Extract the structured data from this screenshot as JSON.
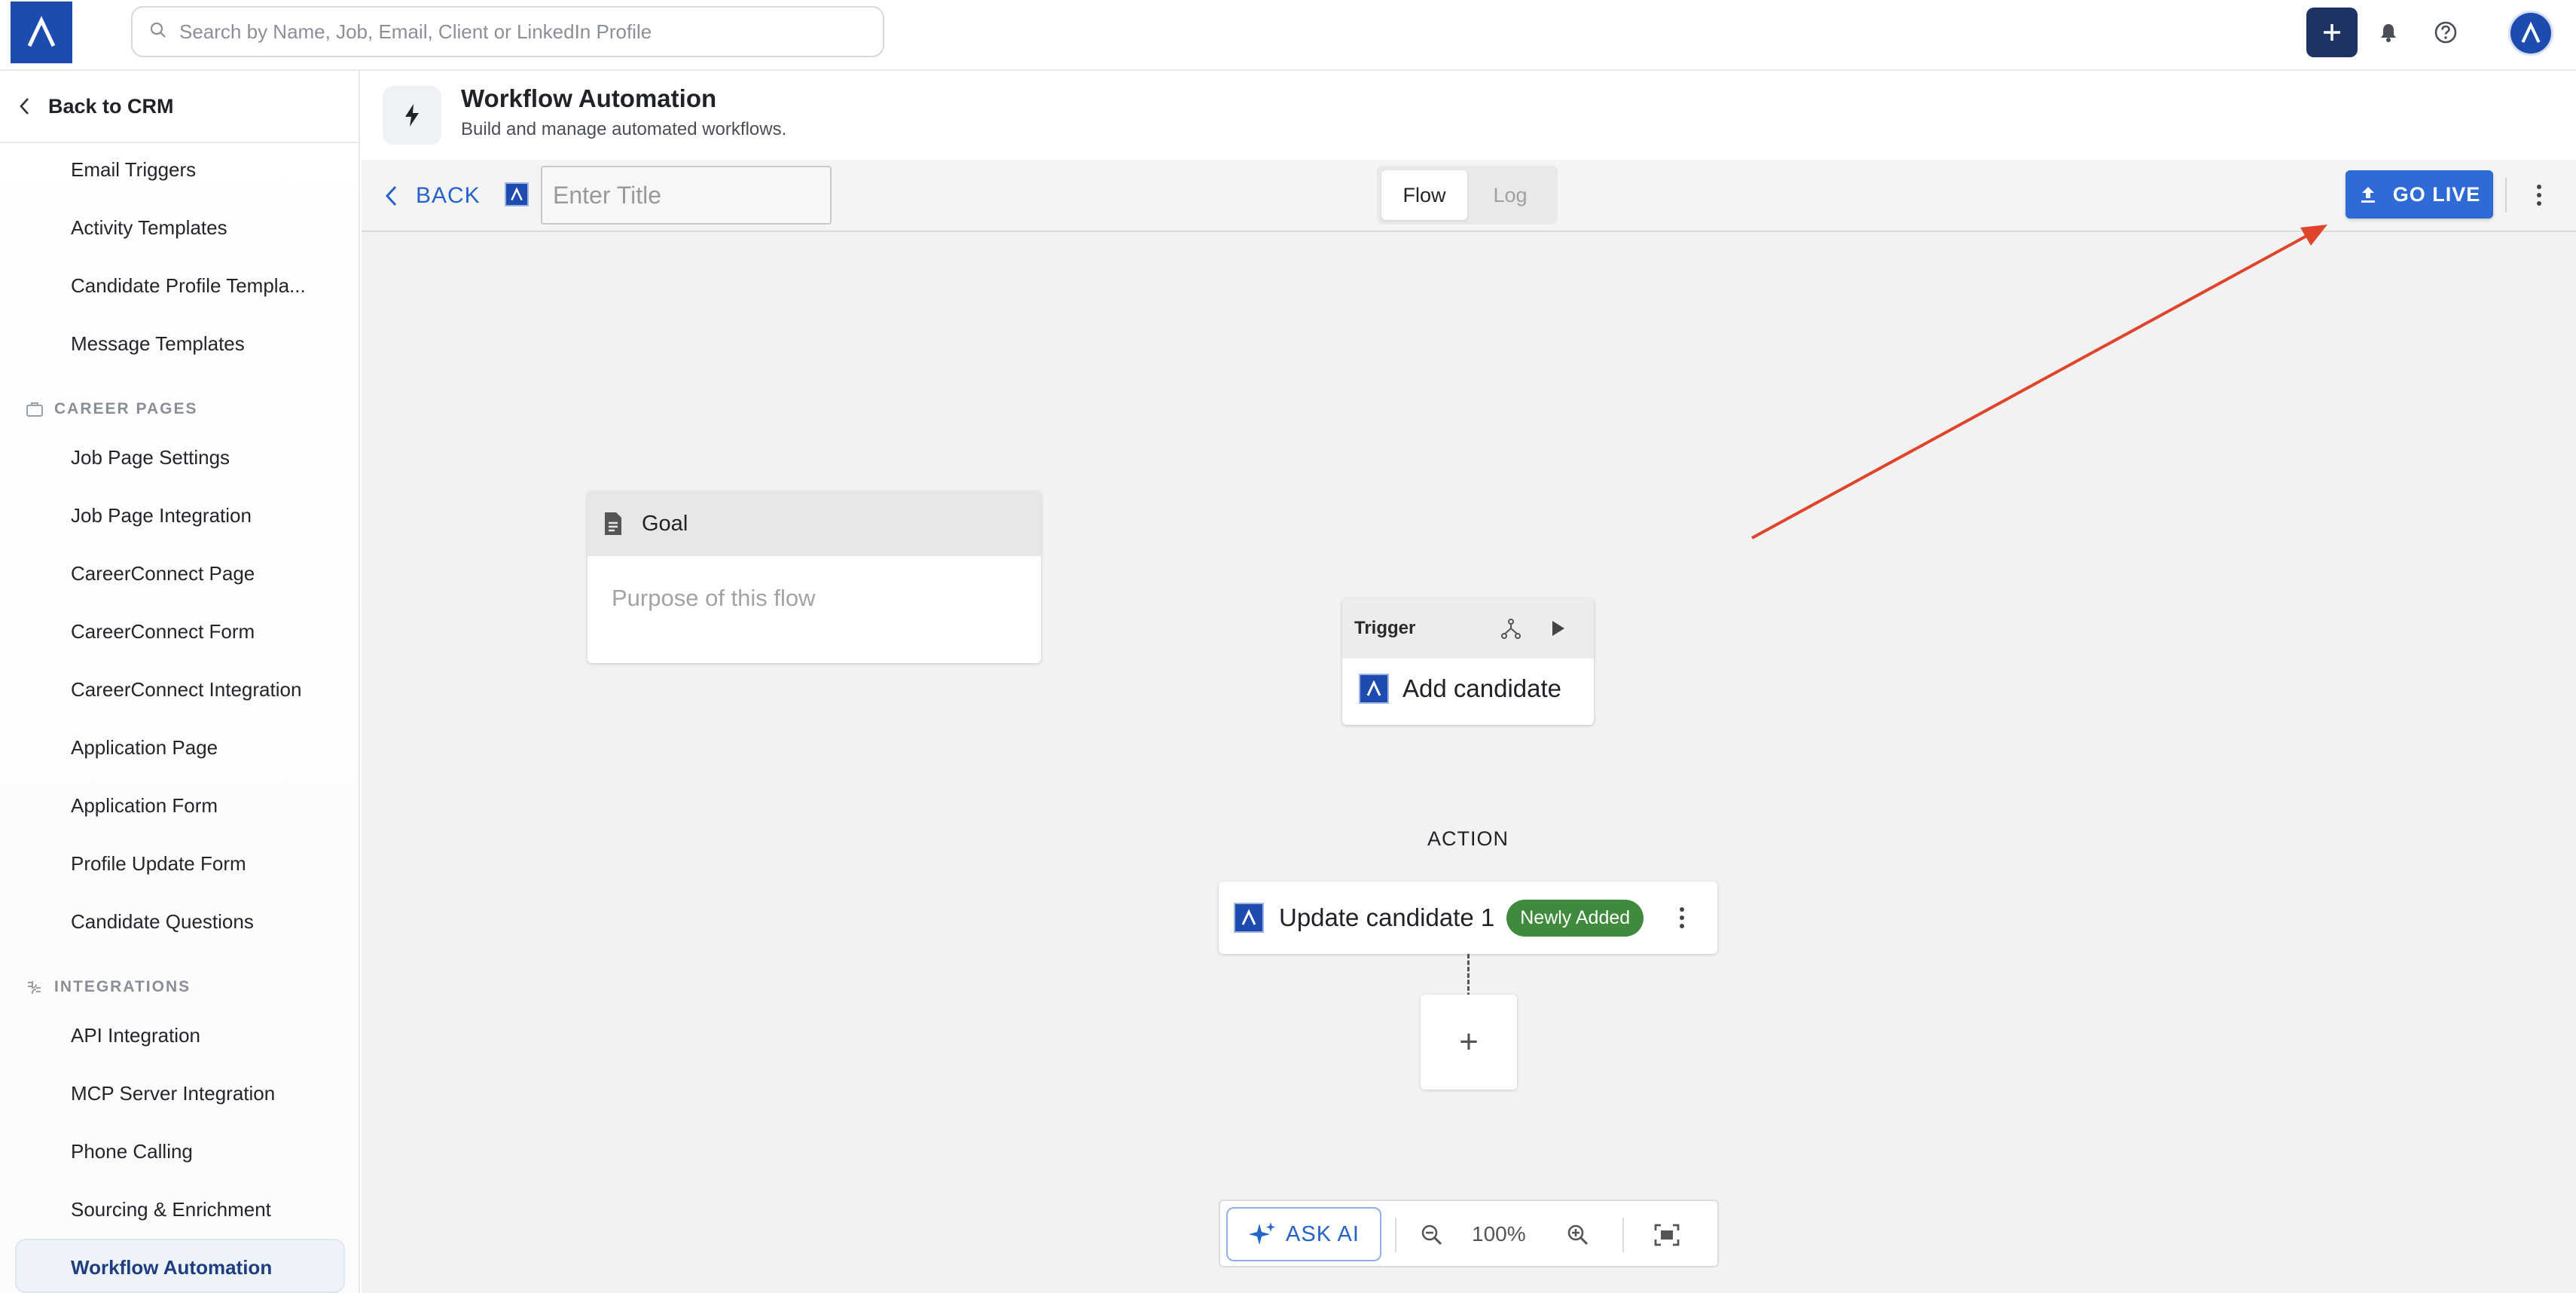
{
  "topbar": {
    "search_placeholder": "Search by Name, Job, Email, Client or LinkedIn Profile",
    "icons": [
      "logo-icon",
      "search-icon",
      "plus-icon",
      "bell-icon",
      "help-icon",
      "avatar-icon"
    ]
  },
  "sidebar": {
    "back_label": "Back to CRM",
    "items_top": [
      "Email Triggers",
      "Activity Templates",
      "Candidate Profile Templa...",
      "Message Templates"
    ],
    "career_pages_heading": "CAREER PAGES",
    "career_pages": [
      "Job Page Settings",
      "Job Page Integration",
      "CareerConnect Page",
      "CareerConnect Form",
      "CareerConnect Integration",
      "Application Page",
      "Application Form",
      "Profile Update Form",
      "Candidate Questions"
    ],
    "integrations_heading": "INTEGRATIONS",
    "integrations": [
      "API Integration",
      "MCP Server Integration",
      "Phone Calling",
      "Sourcing & Enrichment"
    ],
    "active_item": "Workflow Automation"
  },
  "header": {
    "title": "Workflow Automation",
    "subtitle": "Build and manage automated workflows."
  },
  "toolbar": {
    "back_label": "BACK",
    "title_placeholder": "Enter Title",
    "title_value": "",
    "tabs": [
      {
        "label": "Flow",
        "active": true
      },
      {
        "label": "Log",
        "active": false
      }
    ],
    "go_live_label": "GO LIVE"
  },
  "canvas": {
    "goal": {
      "label": "Goal",
      "placeholder": "Purpose of this flow"
    },
    "trigger": {
      "label": "Trigger",
      "action": "Add candidate"
    },
    "action_section_label": "ACTION",
    "action": {
      "label": "Update candidate 1",
      "badge": "Newly Added"
    },
    "add_node_label": "+"
  },
  "zoom": {
    "ask_ai_label": "ASK AI",
    "level": "100%"
  },
  "colors": {
    "brand": "#1d4bb0",
    "primary_button": "#2e6bd6",
    "plus_button": "#1e3264",
    "badge_green": "#3f8a3c",
    "annotation_arrow": "#e0452b"
  }
}
